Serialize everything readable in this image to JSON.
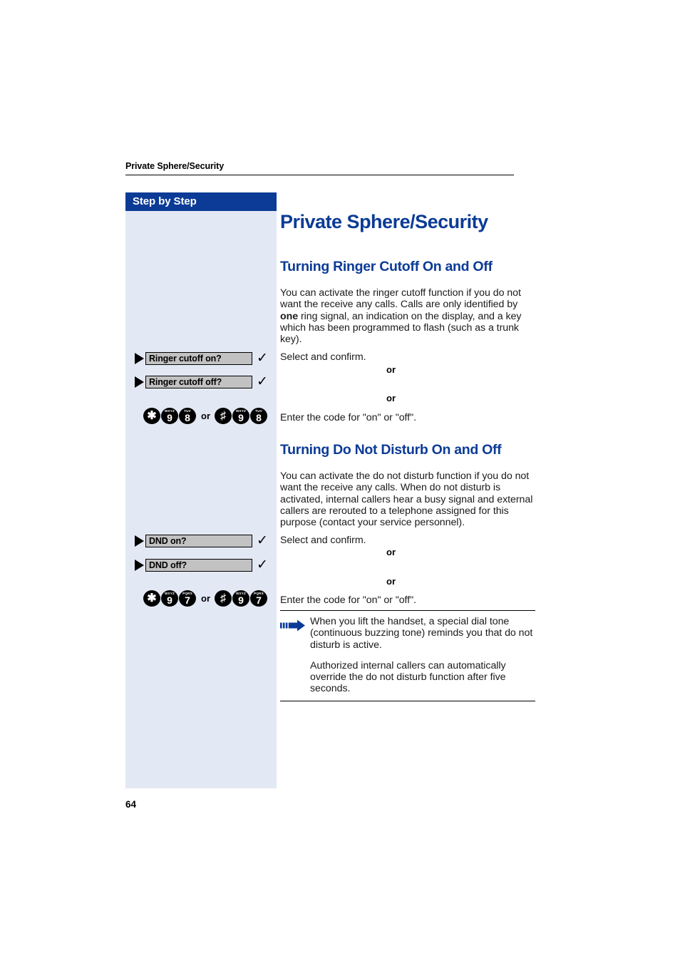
{
  "page": {
    "running_head": "Private Sphere/Security",
    "folio": "64"
  },
  "colors": {
    "brand_blue": "#0b3b96",
    "sidebar_bg": "#e3e8f5",
    "grey_box": "#c2c2c2"
  },
  "sidebar": {
    "header_label": "Step by Step",
    "ringer": {
      "rows": [
        {
          "label": "Ringer cutoff on?",
          "check": "✓"
        },
        {
          "label": "Ringer cutoff off?",
          "check": "✓"
        }
      ],
      "or_1": "or",
      "or_2": "or",
      "keys": {
        "first_sequence": [
          {
            "type": "symbol",
            "glyph": "✱",
            "alpha": ""
          },
          {
            "type": "digit",
            "glyph": "9",
            "alpha": "WXYZ"
          },
          {
            "type": "digit",
            "glyph": "8",
            "alpha": "TUV"
          }
        ],
        "separator": "or",
        "second_sequence": [
          {
            "type": "symbol",
            "glyph": "♯",
            "alpha": ""
          },
          {
            "type": "digit",
            "glyph": "9",
            "alpha": "WXYZ"
          },
          {
            "type": "digit",
            "glyph": "8",
            "alpha": "TUV"
          }
        ]
      }
    },
    "dnd": {
      "rows": [
        {
          "label": "DND on?",
          "check": "✓"
        },
        {
          "label": "DND off?",
          "check": "✓"
        }
      ],
      "or_1": "or",
      "or_2": "or",
      "keys": {
        "first_sequence": [
          {
            "type": "symbol",
            "glyph": "✱",
            "alpha": ""
          },
          {
            "type": "digit",
            "glyph": "9",
            "alpha": "WXYZ"
          },
          {
            "type": "digit",
            "glyph": "7",
            "alpha": "PQRS"
          }
        ],
        "separator": "or",
        "second_sequence": [
          {
            "type": "symbol",
            "glyph": "♯",
            "alpha": ""
          },
          {
            "type": "digit",
            "glyph": "9",
            "alpha": "WXYZ"
          },
          {
            "type": "digit",
            "glyph": "7",
            "alpha": "PQRS"
          }
        ]
      }
    }
  },
  "content": {
    "chapter_title": "Private Sphere/Security",
    "ringer_section": {
      "title": "Turning Ringer Cutoff On and Off",
      "paragraph_part1": "You can activate the ringer cutoff function if you do not want the receive any calls. Calls are only identified by ",
      "paragraph_bold": "one",
      "paragraph_part2": " ring signal, an indication on the display, and a key which has been programmed to flash (such as a trunk key).",
      "select_confirm": "Select and confirm.",
      "enter_code": "Enter the code for \"on\" or \"off\"."
    },
    "dnd_section": {
      "title": "Turning Do Not Disturb On and Off",
      "paragraph": "You can activate the do not disturb function if you do not want the receive any calls. When do not disturb is activated, internal callers hear a busy signal and external callers are rerouted to a telephone assigned for this purpose (contact your service personnel).",
      "select_confirm": "Select and confirm.",
      "enter_code": "Enter the code for \"on\" or \"off\"."
    },
    "note": {
      "paragraph_1": "When you lift the handset, a special dial tone (continuous buzzing tone) reminds you that do not disturb is active.",
      "paragraph_2": "Authorized internal callers can automatically override the do not disturb function after five seconds."
    }
  }
}
